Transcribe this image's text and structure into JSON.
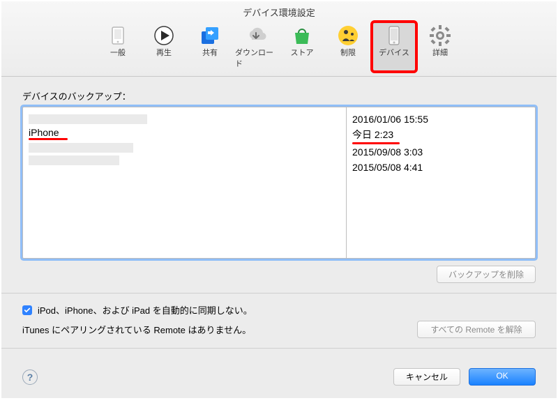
{
  "window": {
    "title": "デバイス環境設定"
  },
  "tabs": [
    {
      "label": "一般"
    },
    {
      "label": "再生"
    },
    {
      "label": "共有"
    },
    {
      "label": "ダウンロード"
    },
    {
      "label": "ストア"
    },
    {
      "label": "制限"
    },
    {
      "label": "デバイス"
    },
    {
      "label": "詳細"
    }
  ],
  "backup": {
    "section_label": "デバイスのバックアップ：",
    "items": [
      {
        "name": "",
        "date": "2016/01/06 15:55"
      },
      {
        "name": "iPhone",
        "date": "今日 2:23"
      },
      {
        "name": "",
        "date": "2015/09/08 3:03"
      },
      {
        "name": "",
        "date": "2015/05/08 4:41"
      }
    ],
    "delete_button": "バックアップを削除"
  },
  "options": {
    "auto_sync_label": "iPod、iPhone、および iPad を自動的に同期しない。",
    "remote_label": "iTunes にペアリングされている Remote はありません。",
    "unpair_button": "すべての Remote を解除"
  },
  "footer": {
    "cancel": "キャンセル",
    "ok": "OK"
  }
}
